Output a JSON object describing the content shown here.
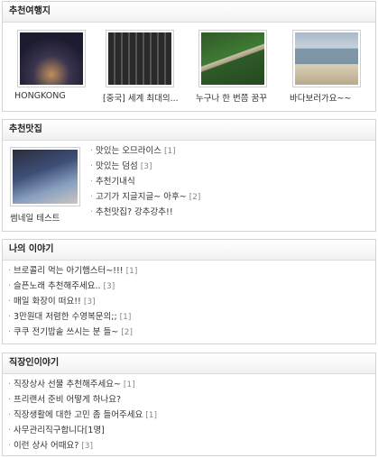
{
  "travel": {
    "title": "추천여행지",
    "items": [
      {
        "caption": "HONGKONG",
        "icon": "night-city-photo"
      },
      {
        "caption": "[중국] 세계 최대의...",
        "icon": "candles-photo"
      },
      {
        "caption": "누구나 한 번쯤 꿈꾸",
        "icon": "tree-branch-photo"
      },
      {
        "caption": "바다보러가요~~",
        "icon": "coastline-photo"
      }
    ]
  },
  "food": {
    "title": "추천맛집",
    "thumb_caption": "썸네일 테스트",
    "thumb_icon": "dusk-sky-photo",
    "items": [
      {
        "text": "맛있는 오므라이스",
        "count": "[1]"
      },
      {
        "text": "맛있는 덤섬",
        "count": "[3]"
      },
      {
        "text": "추천기내식",
        "count": ""
      },
      {
        "text": "고기가 지글지글~ 아후~",
        "count": "[2]"
      },
      {
        "text": "추천맛집? 강추강추!!",
        "count": ""
      }
    ]
  },
  "story": {
    "title": "나의 이야기",
    "items": [
      {
        "text": "브로콜리 먹는 아기햄스터~!!!",
        "count": "[1]"
      },
      {
        "text": "슬픈노래 추천해주세요..",
        "count": "[3]"
      },
      {
        "text": "매일 화장이 떠요!!",
        "count": "[3]"
      },
      {
        "text": "3만원대 저렴한 수영복문의;;",
        "count": "[1]"
      },
      {
        "text": "쿠쿠 전기밥솥 쓰시는 분 들~",
        "count": "[2]"
      }
    ]
  },
  "work": {
    "title": "직장인이야기",
    "items": [
      {
        "text": "직장상사 선물 추천해주세요~",
        "count": "[1]"
      },
      {
        "text": "프리랜서 준비 어떻게 하나요?",
        "count": ""
      },
      {
        "text": "직장생활에 대한 고민 좀 들어주세요",
        "count": "[1]"
      },
      {
        "text": "사무관리직구합니다[1명]",
        "count": ""
      },
      {
        "text": "이런 상사 어때요?",
        "count": "[3]"
      }
    ]
  }
}
